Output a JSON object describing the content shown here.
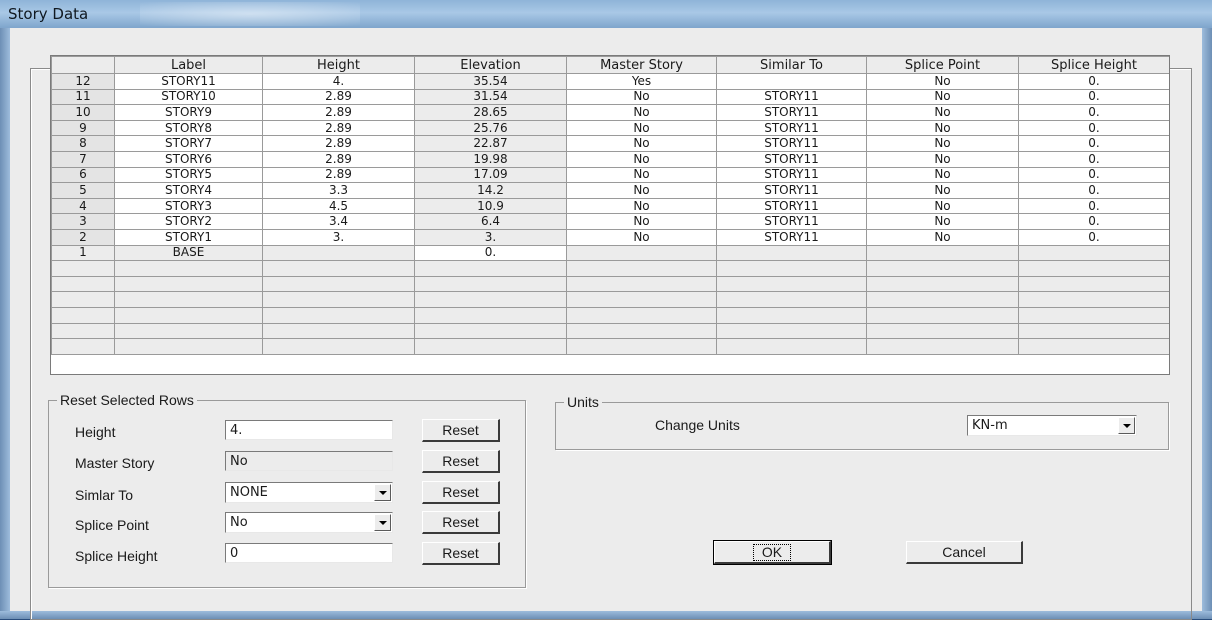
{
  "window": {
    "title": "Story Data"
  },
  "grid": {
    "columns": [
      "",
      "Label",
      "Height",
      "Elevation",
      "Master Story",
      "Similar To",
      "Splice Point",
      "Splice Height"
    ],
    "rows": [
      {
        "num": "12",
        "label": "STORY11",
        "height": "4.",
        "elevation": "35.54",
        "master": "Yes",
        "similar": "",
        "splice_point": "No",
        "splice_height": "0."
      },
      {
        "num": "11",
        "label": "STORY10",
        "height": "2.89",
        "elevation": "31.54",
        "master": "No",
        "similar": "STORY11",
        "splice_point": "No",
        "splice_height": "0."
      },
      {
        "num": "10",
        "label": "STORY9",
        "height": "2.89",
        "elevation": "28.65",
        "master": "No",
        "similar": "STORY11",
        "splice_point": "No",
        "splice_height": "0."
      },
      {
        "num": "9",
        "label": "STORY8",
        "height": "2.89",
        "elevation": "25.76",
        "master": "No",
        "similar": "STORY11",
        "splice_point": "No",
        "splice_height": "0."
      },
      {
        "num": "8",
        "label": "STORY7",
        "height": "2.89",
        "elevation": "22.87",
        "master": "No",
        "similar": "STORY11",
        "splice_point": "No",
        "splice_height": "0."
      },
      {
        "num": "7",
        "label": "STORY6",
        "height": "2.89",
        "elevation": "19.98",
        "master": "No",
        "similar": "STORY11",
        "splice_point": "No",
        "splice_height": "0."
      },
      {
        "num": "6",
        "label": "STORY5",
        "height": "2.89",
        "elevation": "17.09",
        "master": "No",
        "similar": "STORY11",
        "splice_point": "No",
        "splice_height": "0."
      },
      {
        "num": "5",
        "label": "STORY4",
        "height": "3.3",
        "elevation": "14.2",
        "master": "No",
        "similar": "STORY11",
        "splice_point": "No",
        "splice_height": "0."
      },
      {
        "num": "4",
        "label": "STORY3",
        "height": "4.5",
        "elevation": "10.9",
        "master": "No",
        "similar": "STORY11",
        "splice_point": "No",
        "splice_height": "0."
      },
      {
        "num": "3",
        "label": "STORY2",
        "height": "3.4",
        "elevation": "6.4",
        "master": "No",
        "similar": "STORY11",
        "splice_point": "No",
        "splice_height": "0."
      },
      {
        "num": "2",
        "label": "STORY1",
        "height": "3.",
        "elevation": "3.",
        "master": "No",
        "similar": "STORY11",
        "splice_point": "No",
        "splice_height": "0."
      },
      {
        "num": "1",
        "label": "BASE",
        "height": "",
        "elevation": "0.",
        "master": "",
        "similar": "",
        "splice_point": "",
        "splice_height": ""
      }
    ]
  },
  "reset": {
    "legend": "Reset Selected Rows",
    "height_label": "Height",
    "height_value": "4.",
    "master_label": "Master Story",
    "master_value": "No",
    "similar_label": "Simlar To",
    "similar_value": "NONE",
    "splice_point_label": "Splice Point",
    "splice_point_value": "No",
    "splice_height_label": "Splice Height",
    "splice_height_value": "0",
    "reset_button": "Reset"
  },
  "units": {
    "legend": "Units",
    "change_label": "Change Units",
    "value": "KN-m"
  },
  "buttons": {
    "ok": "OK",
    "cancel": "Cancel"
  }
}
